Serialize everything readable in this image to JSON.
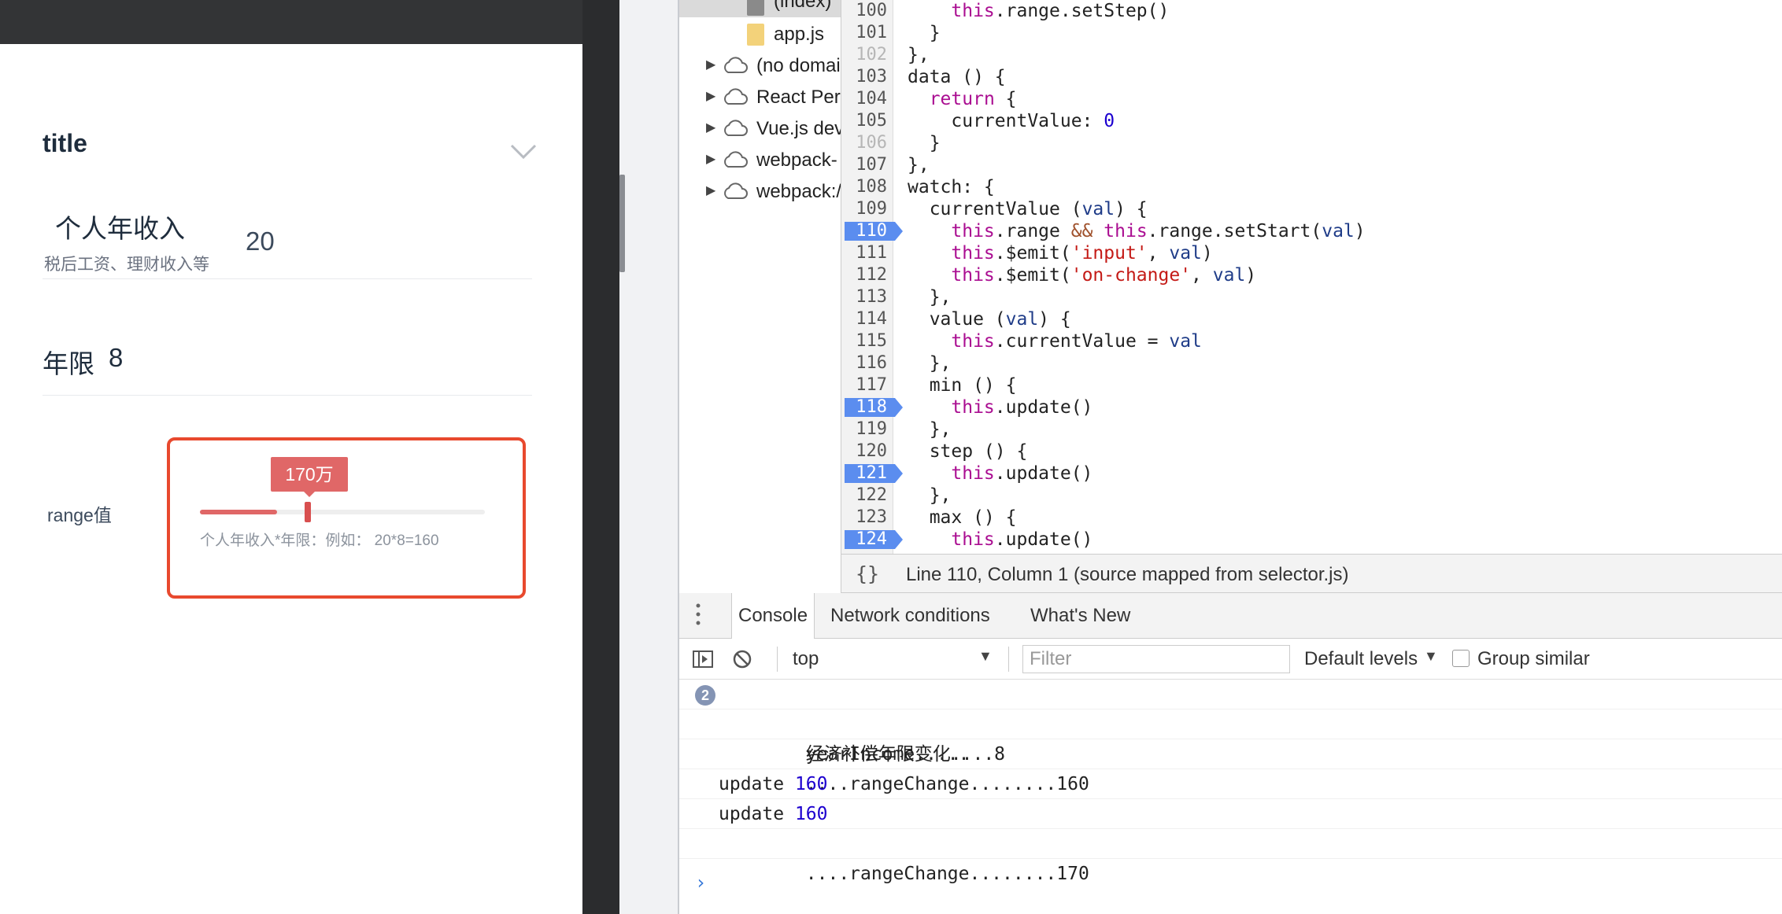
{
  "app": {
    "collapse": {
      "title": "title"
    },
    "income_field": {
      "label": "个人年收入",
      "sublabel": "税后工资、理财收入等",
      "value": "20"
    },
    "years_field": {
      "label": "年限",
      "value": "8"
    },
    "range_field": {
      "label": "range值",
      "tooltip": "170万",
      "hint": "个人年收入*年限：例如：  20*8=160",
      "fill_fraction": 0.27,
      "accent_color": "#e06767",
      "highlight_color": "#e8492e"
    }
  },
  "devtools": {
    "file_tree": [
      {
        "label": "(index)",
        "icon": "file-icon",
        "selected": true
      },
      {
        "label": "app.js",
        "icon": "js-file-icon"
      },
      {
        "label": "(no domai",
        "icon": "cloud-icon",
        "expandable": true
      },
      {
        "label": "React Per",
        "icon": "cloud-icon",
        "expandable": true
      },
      {
        "label": "Vue.js dev",
        "icon": "cloud-icon",
        "expandable": true
      },
      {
        "label": "webpack-",
        "icon": "cloud-icon",
        "expandable": true
      },
      {
        "label": "webpack:/",
        "icon": "cloud-icon",
        "expandable": true
      }
    ],
    "code": {
      "line_numbers": [
        "100",
        "101",
        "102",
        "103",
        "104",
        "105",
        "106",
        "107",
        "108",
        "109",
        "110",
        "111",
        "112",
        "113",
        "114",
        "115",
        "116",
        "117",
        "118",
        "119",
        "120",
        "121",
        "122",
        "123",
        "124"
      ],
      "breakpoint_lines": [
        "110",
        "118",
        "121",
        "124"
      ],
      "faded_lines": [
        "102",
        "106"
      ]
    },
    "status_bar": {
      "brace": "{}",
      "text": "Line 110, Column 1   (source mapped from selector.js)"
    },
    "drawer_tabs": [
      "Console",
      "Network conditions",
      "What's New"
    ],
    "console_toolbar": {
      "context": "top",
      "filter_placeholder": "Filter",
      "levels": "Default levels",
      "group_similar": "Group similar"
    },
    "console_log": [
      {
        "text": "yearIncome.....",
        "repeat": "2"
      },
      {
        "text": "经济补偿年限变化....8"
      },
      {
        "text": "....rangeChange........160"
      },
      {
        "text": "update ",
        "num": "160"
      },
      {
        "text": "update ",
        "num": "160"
      },
      {
        "text": "....rangeChange........170"
      }
    ],
    "prompt_symbol": "›"
  }
}
